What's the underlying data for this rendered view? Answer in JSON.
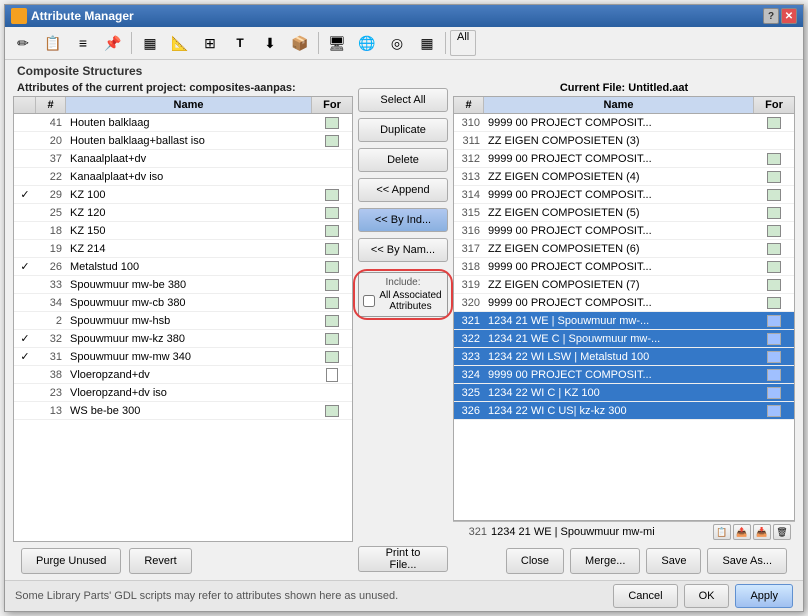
{
  "window": {
    "title": "Attribute Manager",
    "icon": "⚙"
  },
  "toolbar": {
    "buttons": [
      {
        "name": "toolbar-btn-1",
        "icon": "✏"
      },
      {
        "name": "toolbar-btn-2",
        "icon": "📋"
      },
      {
        "name": "toolbar-btn-3",
        "icon": "≡"
      },
      {
        "name": "toolbar-btn-4",
        "icon": "📌"
      },
      {
        "name": "toolbar-btn-5",
        "icon": "▦"
      },
      {
        "name": "toolbar-btn-6",
        "icon": "📐"
      },
      {
        "name": "toolbar-btn-7",
        "icon": "⊞"
      },
      {
        "name": "toolbar-btn-8",
        "icon": "T"
      },
      {
        "name": "toolbar-btn-9",
        "icon": "⬇"
      },
      {
        "name": "toolbar-btn-10",
        "icon": "📦"
      },
      {
        "name": "toolbar-btn-11",
        "icon": "🖥"
      },
      {
        "name": "toolbar-btn-12",
        "icon": "🌐"
      },
      {
        "name": "toolbar-btn-13",
        "icon": "◎"
      },
      {
        "name": "toolbar-btn-14",
        "icon": "▦"
      }
    ],
    "all_label": "All"
  },
  "section_title": "Composite Structures",
  "left_panel": {
    "header": "Attributes of the current project: composites-aanpas:",
    "columns": {
      "check": "",
      "num": "#",
      "name": "Name",
      "for": "For"
    },
    "rows": [
      {
        "num": 41,
        "name": "Houten balklaag",
        "check": false,
        "for": "img"
      },
      {
        "num": 20,
        "name": "Houten balklaag+ballast iso",
        "check": false,
        "for": "img"
      },
      {
        "num": 37,
        "name": "Kanaalplaat+dv",
        "check": false,
        "for": ""
      },
      {
        "num": 22,
        "name": "Kanaalplaat+dv iso",
        "check": false,
        "for": ""
      },
      {
        "num": 29,
        "name": "KZ 100",
        "check": true,
        "for": "img"
      },
      {
        "num": 25,
        "name": "KZ 120",
        "check": false,
        "for": "img"
      },
      {
        "num": 18,
        "name": "KZ 150",
        "check": false,
        "for": "img"
      },
      {
        "num": 19,
        "name": "KZ 214",
        "check": false,
        "for": "img"
      },
      {
        "num": 26,
        "name": "Metalstud 100",
        "check": true,
        "for": "img"
      },
      {
        "num": 33,
        "name": "Spouwmuur mw-be 380",
        "check": false,
        "for": "img"
      },
      {
        "num": 34,
        "name": "Spouwmuur mw-cb 380",
        "check": false,
        "for": "img"
      },
      {
        "num": 2,
        "name": "Spouwmuur mw-hsb",
        "check": false,
        "for": "img"
      },
      {
        "num": 32,
        "name": "Spouwmuur mw-kz 380",
        "check": true,
        "for": "img"
      },
      {
        "num": 31,
        "name": "Spouwmuur mw-mw 340",
        "check": true,
        "for": "img"
      },
      {
        "num": 38,
        "name": "Vloeropzand+dv",
        "check": false,
        "for": "doc"
      },
      {
        "num": 23,
        "name": "Vloeropzand+dv iso",
        "check": false,
        "for": ""
      },
      {
        "num": 13,
        "name": "WS be-be 300",
        "check": false,
        "for": "img"
      }
    ]
  },
  "mid_buttons": {
    "select_all": "Select All",
    "duplicate": "Duplicate",
    "delete": "Delete",
    "append": "<< Append",
    "by_index": "<< By Ind...",
    "by_name": "<< By Nam...",
    "include_label": "Include:",
    "all_assoc": "All Associated Attributes",
    "all_assoc_check": false
  },
  "right_panel": {
    "header": "Current File: Untitled.aat",
    "columns": {
      "num": "#",
      "name": "Name",
      "for": "For"
    },
    "rows": [
      {
        "num": 310,
        "name": "9999 00 PROJECT COMPOSIT...",
        "for": "img",
        "selected": false
      },
      {
        "num": 311,
        "name": "ZZ EIGEN COMPOSIETEN (3)",
        "for": "doc",
        "selected": false
      },
      {
        "num": 312,
        "name": "9999 00 PROJECT COMPOSIT...",
        "for": "img",
        "selected": false
      },
      {
        "num": 313,
        "name": "ZZ EIGEN COMPOSIETEN (4)",
        "for": "img",
        "selected": false
      },
      {
        "num": 314,
        "name": "9999 00 PROJECT COMPOSIT...",
        "for": "img",
        "selected": false
      },
      {
        "num": 315,
        "name": "ZZ EIGEN COMPOSIETEN (5)",
        "for": "img",
        "selected": false
      },
      {
        "num": 316,
        "name": "9999 00 PROJECT COMPOSIT...",
        "for": "img",
        "selected": false
      },
      {
        "num": 317,
        "name": "ZZ EIGEN COMPOSIETEN (6)",
        "for": "img",
        "selected": false
      },
      {
        "num": 318,
        "name": "9999 00 PROJECT COMPOSIT...",
        "for": "img",
        "selected": false
      },
      {
        "num": 319,
        "name": "ZZ EIGEN COMPOSIETEN (7)",
        "for": "img",
        "selected": false
      },
      {
        "num": 320,
        "name": "9999 00 PROJECT COMPOSIT...",
        "for": "img",
        "selected": false
      },
      {
        "num": 321,
        "name": "1234 21 WE | Spouwmuur mw-...",
        "for": "img",
        "selected": true
      },
      {
        "num": 322,
        "name": "1234 21 WE C | Spouwmuur mw-...",
        "for": "img",
        "selected": true
      },
      {
        "num": 323,
        "name": "1234 22 WI LSW | Metalstud 100",
        "for": "img",
        "selected": true
      },
      {
        "num": 324,
        "name": "9999 00 PROJECT COMPOSIT...",
        "for": "img",
        "selected": true
      },
      {
        "num": 325,
        "name": "1234 22 WI C | KZ 100",
        "for": "img",
        "selected": true
      },
      {
        "num": 326,
        "name": "1234 22 WI C US| kz-kz 300",
        "for": "img",
        "selected": true
      }
    ],
    "footer": {
      "num": 321,
      "name": "1234 21 WE | Spouwmuur mw-mi"
    }
  },
  "bottom_left": {
    "purge_unused": "Purge Unused",
    "revert": "Revert",
    "print_to_file": "Print to File..."
  },
  "right_actions": {
    "close": "Close",
    "merge": "Merge...",
    "save": "Save",
    "save_as": "Save As..."
  },
  "status": {
    "message": "Some Library Parts' GDL scripts may refer to attributes shown here as unused.",
    "cancel": "Cancel",
    "ok": "OK",
    "apply": "Apply"
  }
}
